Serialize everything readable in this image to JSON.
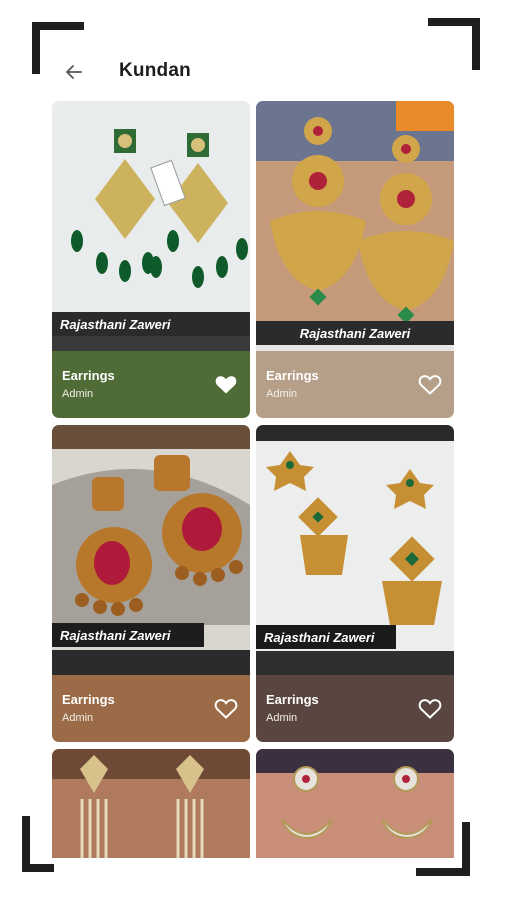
{
  "header": {
    "title": "Kundan"
  },
  "products": [
    {
      "category": "Earrings",
      "subtitle": "Admin",
      "watermark": "Rajasthani Zaweri",
      "bar_color": "#4f6b36",
      "favorited": true
    },
    {
      "category": "Earrings",
      "subtitle": "Admin",
      "watermark": "Rajasthani Zaweri",
      "bar_color": "#b59f88",
      "favorited": false
    },
    {
      "category": "Earrings",
      "subtitle": "Admin",
      "watermark": "Rajasthani Zaweri",
      "bar_color": "#9a6b46",
      "favorited": false
    },
    {
      "category": "Earrings",
      "subtitle": "Admin",
      "watermark": "Rajasthani Zaweri",
      "bar_color": "#5a4640",
      "favorited": false
    }
  ],
  "icons": {
    "back": "arrow-left-icon",
    "favorite": "heart-icon"
  }
}
